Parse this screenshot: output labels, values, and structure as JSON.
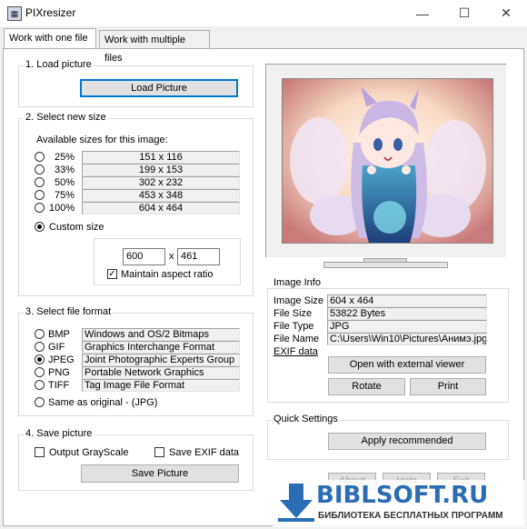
{
  "window": {
    "title": "PIXresizer",
    "minimize": "—",
    "maximize": "☐",
    "close": "✕"
  },
  "tabs": [
    "Work with one file",
    "Work with multiple files"
  ],
  "load": {
    "legend": "1. Load picture",
    "button": "Load Picture"
  },
  "size": {
    "legend": "2. Select new size",
    "available_label": "Available sizes for this image:",
    "options": [
      {
        "pct": "25%",
        "dims": "151 x 116"
      },
      {
        "pct": "33%",
        "dims": "199 x 153"
      },
      {
        "pct": "50%",
        "dims": "302 x 232"
      },
      {
        "pct": "75%",
        "dims": "453 x 348"
      },
      {
        "pct": "100%",
        "dims": "604 x 464"
      }
    ],
    "custom_label": "Custom size",
    "width": "600",
    "x_sep": "x",
    "height": "461",
    "aspect_label": "Maintain aspect ratio"
  },
  "format": {
    "legend": "3. Select file format",
    "options": [
      {
        "name": "BMP",
        "desc": "Windows and OS/2 Bitmaps"
      },
      {
        "name": "GIF",
        "desc": "Graphics Interchange Format"
      },
      {
        "name": "JPEG",
        "desc": "Joint Photographic Experts Group"
      },
      {
        "name": "PNG",
        "desc": "Portable Network Graphics"
      },
      {
        "name": "TIFF",
        "desc": "Tag Image File Format"
      }
    ],
    "same_label": "Same as original  - (JPG)"
  },
  "save": {
    "legend": "4. Save picture",
    "grayscale_label": "Output GrayScale",
    "exif_label": "Save EXIF data",
    "button": "Save Picture"
  },
  "info": {
    "legend": "Image Info",
    "rows": [
      {
        "label": "Image Size",
        "value": "604 x 464"
      },
      {
        "label": "File Size",
        "value": "53822 Bytes"
      },
      {
        "label": "File Type",
        "value": "JPG"
      },
      {
        "label": "File Name",
        "value": "C:\\Users\\Win10\\Pictures\\Анимэ.jpg"
      }
    ],
    "exif_link": "EXIF data",
    "open_button": "Open with external viewer",
    "rotate_button": "Rotate",
    "print_button": "Print"
  },
  "quick": {
    "legend": "Quick Settings",
    "button": "Apply recommended"
  },
  "footer": {
    "about": "About",
    "help": "Help",
    "exit": "Exit"
  },
  "watermark": {
    "brand": "BIBLSOFT.RU",
    "tagline": "БИБЛИОТЕКА БЕСПЛАТНЫХ ПРОГРАММ"
  },
  "colors": {
    "accent": "#0078d7",
    "watermark_blue": "#2a6db5"
  }
}
